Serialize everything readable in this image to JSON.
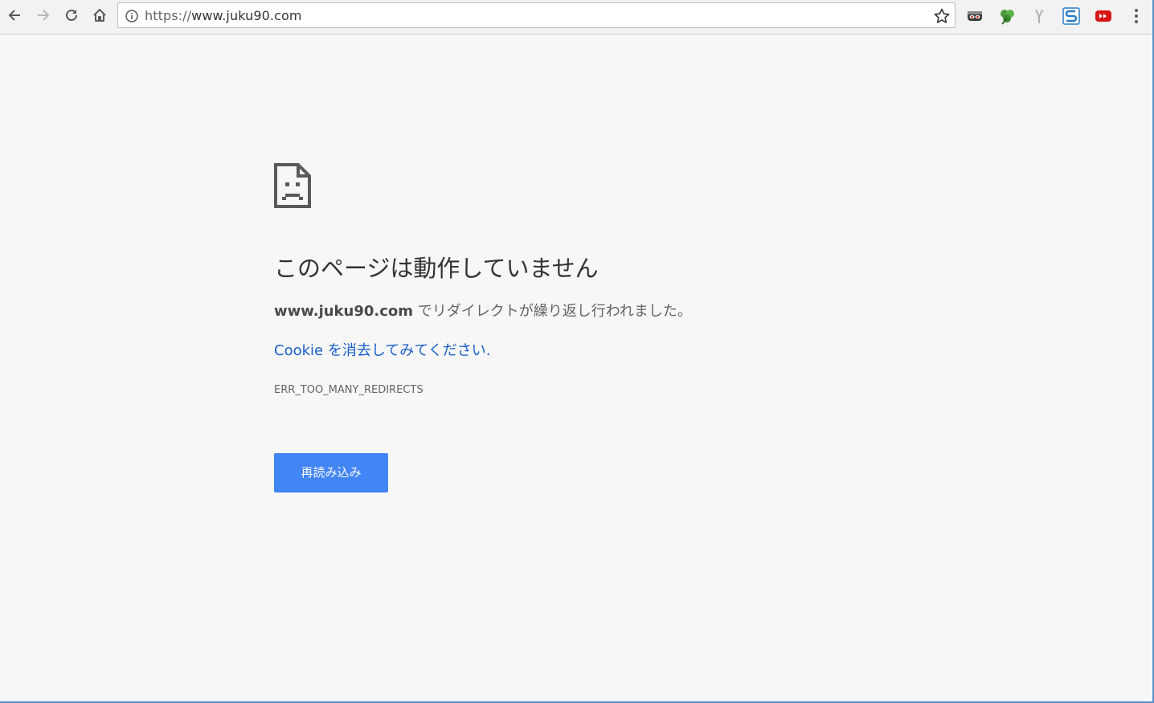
{
  "browser": {
    "omnibox": {
      "url_scheme": "https://",
      "url_host": "www.juku90.com"
    },
    "nav_icons": [
      "back-arrow-icon",
      "forward-arrow-icon",
      "reload-icon",
      "home-icon"
    ],
    "extension_icons": [
      "mask-extension-icon",
      "clover-extension-icon",
      "fork-extension-icon",
      "s-extension-icon",
      "youtube-extension-icon"
    ]
  },
  "error_page": {
    "icon": "sad-page-icon",
    "headline": "このページは動作していません",
    "summary_host": "www.juku90.com",
    "summary_text": " でリダイレクトが繰り返し行われました。",
    "suggestion": "Cookie を消去してみてください.",
    "error_code": "ERR_TOO_MANY_REDIRECTS",
    "reload_button": "再読み込み"
  },
  "colors": {
    "button_blue": "#4285f4",
    "link_blue": "#1a5fc9",
    "page_bg": "#f7f7f7"
  }
}
